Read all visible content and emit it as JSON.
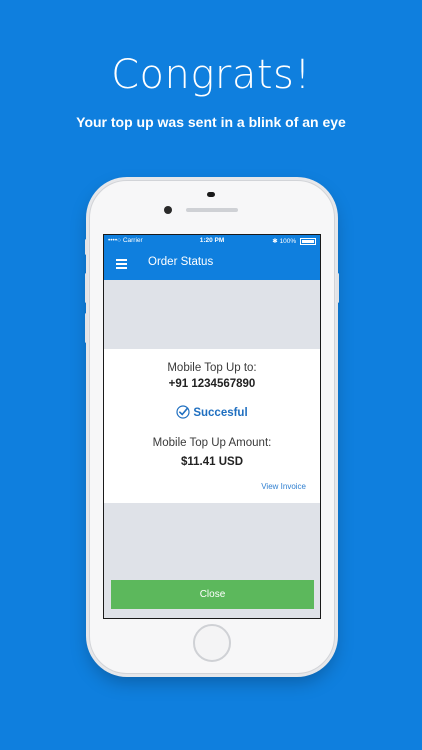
{
  "promo": {
    "headline": "Congrats!",
    "subheadline": "Your top up was sent in a blink of an eye"
  },
  "status_bar": {
    "carrier": "••••○ Carrier",
    "time": "1:20 PM",
    "battery": "100%"
  },
  "nav": {
    "title": "Order Status"
  },
  "order": {
    "recipient_label": "Mobile Top Up to:",
    "recipient_number": "+91 1234567890",
    "status": "Succesful",
    "amount_label": "Mobile Top Up Amount:",
    "amount": "$11.41 USD",
    "invoice_link": "View Invoice"
  },
  "actions": {
    "close_label": "Close"
  },
  "colors": {
    "brand_blue": "#0f7fde",
    "success_green": "#5cb85c",
    "status_blue": "#1f6fc0"
  }
}
